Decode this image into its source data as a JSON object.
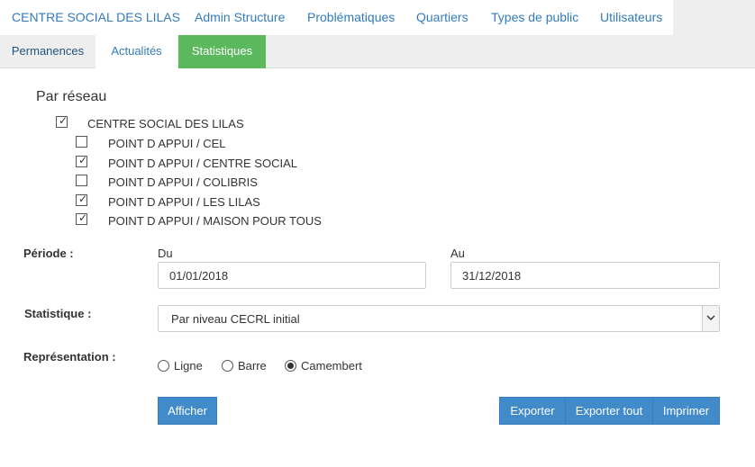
{
  "top_nav": {
    "items": [
      "CENTRE SOCIAL DES LILAS",
      "Admin Structure",
      "Problématiques",
      "Quartiers",
      "Types de public",
      "Utilisateurs"
    ]
  },
  "sub_nav": {
    "tabs": [
      "Permanences",
      "Actualités",
      "Statistiques"
    ],
    "active": "Statistiques"
  },
  "network": {
    "title": "Par réseau",
    "root": {
      "label": "CENTRE SOCIAL DES LILAS",
      "checked": true
    },
    "children": [
      {
        "label": "POINT D APPUI / CEL",
        "checked": false
      },
      {
        "label": "POINT D APPUI / CENTRE SOCIAL",
        "checked": true
      },
      {
        "label": "POINT D APPUI / COLIBRIS",
        "checked": false
      },
      {
        "label": "POINT D APPUI / LES LILAS",
        "checked": true
      },
      {
        "label": "POINT D APPUI / MAISON POUR TOUS",
        "checked": true
      }
    ]
  },
  "period": {
    "label": "Période :",
    "from_label": "Du",
    "from_value": "01/01/2018",
    "to_label": "Au",
    "to_value": "31/12/2018"
  },
  "statistic": {
    "label": "Statistique :",
    "selected": "Par niveau CECRL initial"
  },
  "representation": {
    "label": "Représentation :",
    "options": [
      "Ligne",
      "Barre",
      "Camembert"
    ],
    "selected": "Camembert"
  },
  "actions": {
    "show": "Afficher",
    "export": "Exporter",
    "export_all": "Exporter tout",
    "print": "Imprimer"
  },
  "colors": {
    "link": "#337ab7",
    "active_tab": "#5cb85c",
    "button": "#428bca"
  }
}
